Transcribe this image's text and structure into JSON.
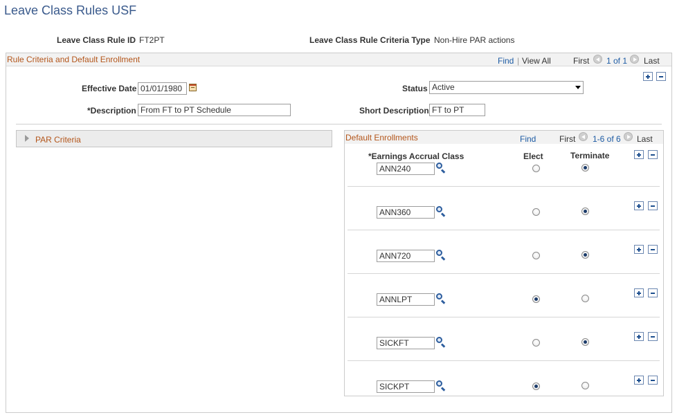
{
  "page": {
    "title": "Leave Class Rules USF"
  },
  "header": {
    "rule_id_label": "Leave Class Rule ID",
    "rule_id_value": "FT2PT",
    "criteria_type_label": "Leave Class Rule Criteria Type",
    "criteria_type_value": "Non-Hire PAR actions"
  },
  "rule_section": {
    "title": "Rule Criteria and Default Enrollment",
    "nav": {
      "find": "Find",
      "separator": "|",
      "view_all": "View All",
      "first": "First",
      "range": "1 of 1",
      "last": "Last"
    },
    "effective_date_label": "Effective Date",
    "effective_date_value": "01/01/1980",
    "status_label": "Status",
    "status_value": "Active",
    "description_label": "*Description",
    "description_value": "From FT to PT Schedule",
    "short_description_label": "Short Description",
    "short_description_value": "FT to PT"
  },
  "par_criteria": {
    "title": "PAR Criteria",
    "expanded": false
  },
  "default_enrollments": {
    "title": "Default Enrollments",
    "nav": {
      "find": "Find",
      "first": "First",
      "range": "1-6 of 6",
      "last": "Last"
    },
    "columns": {
      "accrual_class": "*Earnings Accrual Class",
      "elect": "Elect",
      "terminate": "Terminate"
    },
    "rows": [
      {
        "accrual_class": "ANN240",
        "selected": "terminate"
      },
      {
        "accrual_class": "ANN360",
        "selected": "terminate"
      },
      {
        "accrual_class": "ANN720",
        "selected": "terminate"
      },
      {
        "accrual_class": "ANNLPT",
        "selected": "elect"
      },
      {
        "accrual_class": "SICKFT",
        "selected": "terminate"
      },
      {
        "accrual_class": "SICKPT",
        "selected": "elect"
      }
    ]
  },
  "colors": {
    "title_blue": "#3a5a8c",
    "section_orange": "#b3551a",
    "link_blue": "#1d5ba4"
  },
  "icons": {
    "nav_prev": "chevron-left-circle-icon",
    "nav_next": "chevron-right-circle-icon",
    "add_row": "plus-icon",
    "delete_row": "minus-icon",
    "calendar": "calendar-icon",
    "lookup": "magnifier-icon",
    "expand": "triangle-right-icon"
  }
}
